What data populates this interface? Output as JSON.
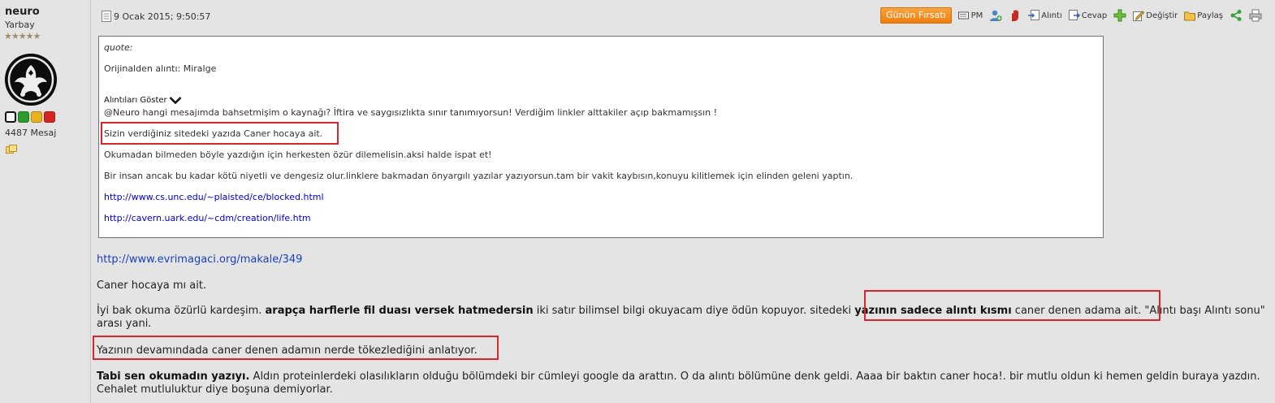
{
  "user": {
    "name": "neuro",
    "rank": "Yarbay",
    "stars": "★★★★★",
    "post_count": "4487 Mesaj",
    "status_colors": [
      "#ffffff",
      "#2e9b2e",
      "#e7b21b",
      "#d6241f"
    ]
  },
  "post": {
    "date": "9 Ocak 2015; 9:50:57",
    "actions": {
      "deal": "Günün Fırsatı",
      "pm": "PM",
      "quote": "Alıntı",
      "reply": "Cevap",
      "edit": "Değiştir",
      "share": "Paylaş"
    },
    "quote": {
      "label": "quote:",
      "origin": "Orijinalden alıntı: Miralge",
      "show_quotes": "Alıntıları Göster",
      "lines": [
        "@Neuro hangi mesajımda bahsetmişim o kaynağı? İftira ve saygısızlıkta sınır tanımıyorsun! Verdiğim linkler alttakiler açıp bakmamışsın !",
        "Sizin verdiğiniz sitedeki yazıda Caner hocaya ait.",
        "Okumadan bilmeden böyle yazdığın için herkesten özür dilemelisin.aksi halde ispat et!",
        "Bir insan ancak bu kadar kötü niyetli ve dengesiz olur.linklere bakmadan önyargılı yazılar yazıyorsun.tam bir vakit kaybısın,konuyu kilitlemek için elinden geleni yaptın."
      ],
      "links": [
        "http://www.cs.unc.edu/~plaisted/ce/blocked.html",
        "http://cavern.uark.edu/~cdm/creation/life.htm"
      ]
    },
    "body": {
      "link": "http://www.evrimagaci.org/makale/349",
      "p1": "Caner hocaya mı ait.",
      "p2_a": "İyi bak okuma özürlü kardeşim. ",
      "p2_b": "arapça harflerle fil duası versek hatmedersin",
      "p2_c": " iki satır bilimsel bilgi okuyacam diye ödün kopuyor. sitedeki ",
      "p2_d": "yazının sadece alıntı kısmı",
      "p2_e": " caner denen adama ait. \"Alıntı başı Alıntı sonu\" arası yani.",
      "p3": "Yazının devamındada caner denen adamın nerde tökezlediğini anlatıyor.",
      "p4_a": "Tabi sen okumadın yazıyı.",
      "p4_b": " Aldın proteinlerdeki olasılıkların olduğu bölümdeki bir cümleyi google da arattın. O da alıntı bölümüne denk geldi. Aaaa bir baktın caner hoca!. bir mutlu oldun ki hemen geldin buraya yazdın. Cehalet mutluluktur diye boşuna demiyorlar."
    }
  }
}
